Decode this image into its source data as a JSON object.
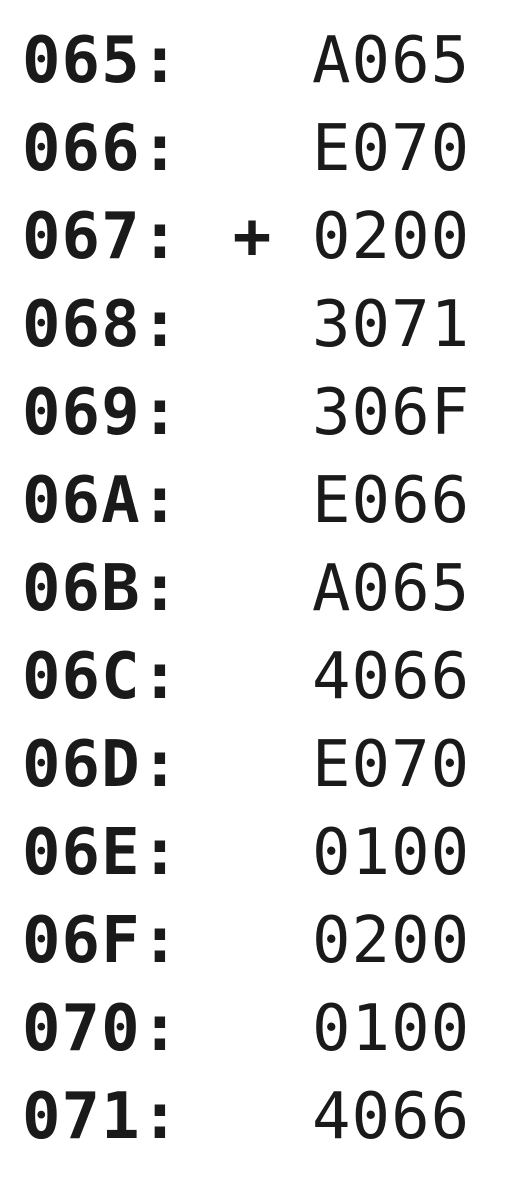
{
  "memory_rows": [
    {
      "address": "065:",
      "marker": "",
      "value": "A065"
    },
    {
      "address": "066:",
      "marker": "",
      "value": "E070"
    },
    {
      "address": "067:",
      "marker": "+",
      "value": "0200"
    },
    {
      "address": "068:",
      "marker": "",
      "value": "3071"
    },
    {
      "address": "069:",
      "marker": "",
      "value": "306F"
    },
    {
      "address": "06A:",
      "marker": "",
      "value": "E066"
    },
    {
      "address": "06B:",
      "marker": "",
      "value": "A065"
    },
    {
      "address": "06C:",
      "marker": "",
      "value": "4066"
    },
    {
      "address": "06D:",
      "marker": "",
      "value": "E070"
    },
    {
      "address": "06E:",
      "marker": "",
      "value": "0100"
    },
    {
      "address": "06F:",
      "marker": "",
      "value": "0200"
    },
    {
      "address": "070:",
      "marker": "",
      "value": "0100"
    },
    {
      "address": "071:",
      "marker": "",
      "value": "4066"
    }
  ]
}
